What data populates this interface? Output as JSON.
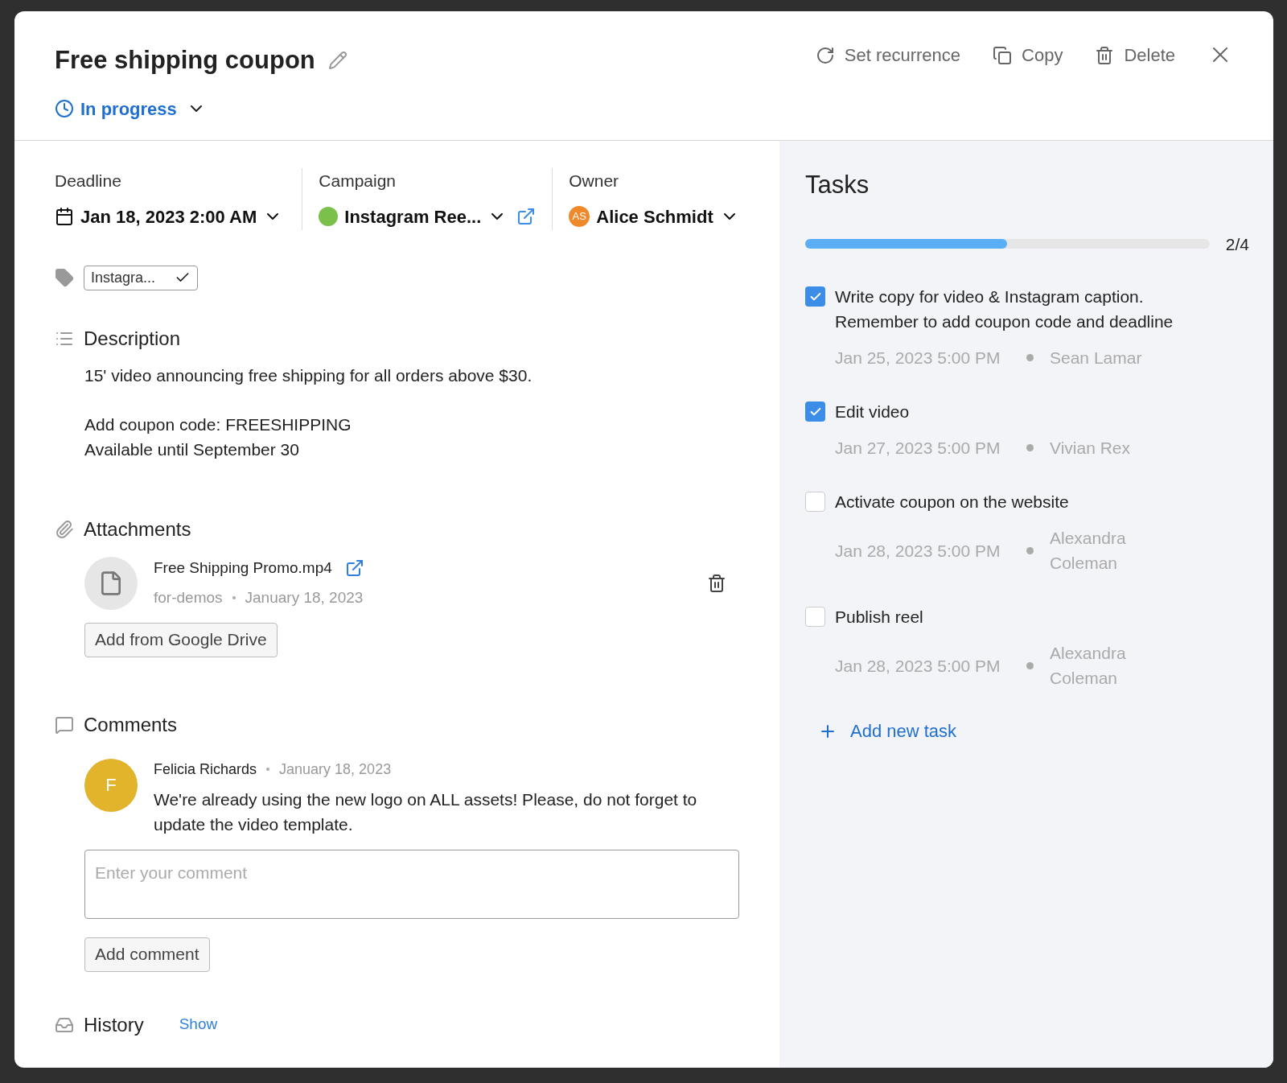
{
  "header": {
    "title": "Free shipping coupon",
    "status": "In progress",
    "actions": [
      {
        "kind": "recurrence",
        "label": "Set recurrence"
      },
      {
        "kind": "copy",
        "label": "Copy"
      },
      {
        "kind": "delete",
        "label": "Delete"
      }
    ]
  },
  "fields": {
    "deadline": {
      "label": "Deadline",
      "value": "Jan 18, 2023 2:00 AM"
    },
    "campaign": {
      "label": "Campaign",
      "value": "Instagram Ree...",
      "color": "#7bc04a"
    },
    "owner": {
      "label": "Owner",
      "initials": "AS",
      "value": "Alice Schmidt"
    }
  },
  "tag": {
    "label": "Instagra..."
  },
  "description": {
    "title": "Description",
    "paragraphs": [
      "15' video announcing free shipping for all orders above $30.",
      "Add coupon code: FREESHIPPING\nAvailable until September 30"
    ]
  },
  "attachments": {
    "title": "Attachments",
    "files": [
      {
        "name": "Free Shipping Promo.mp4",
        "source": "for-demos",
        "date": "January 18, 2023"
      }
    ],
    "button": "Add from Google Drive"
  },
  "comments": {
    "title": "Comments",
    "items": [
      {
        "initial": "F",
        "author": "Felicia Richards",
        "date": "January 18, 2023",
        "text": "We're already using the new logo on ALL assets! Please, do not forget to update the video template."
      }
    ],
    "placeholder": "Enter your comment",
    "button": "Add comment"
  },
  "history": {
    "title": "History",
    "link": "Show"
  },
  "tasks": {
    "title": "Tasks",
    "level": 0.5,
    "count": "2/4",
    "items": [
      {
        "text": "Write copy for video & Instagram caption. Remember to add coupon code and deadline",
        "checked": true,
        "date": "Jan 25, 2023 5:00 PM",
        "assignee": "Sean Lamar"
      },
      {
        "text": "Edit video",
        "checked": true,
        "date": "Jan 27, 2023 5:00 PM",
        "assignee": "Vivian Rex"
      },
      {
        "text": "Activate coupon on the website",
        "checked": false,
        "date": "Jan 28, 2023 5:00 PM",
        "assignee": "Alexandra Coleman"
      },
      {
        "text": "Publish reel",
        "checked": false,
        "date": "Jan 28, 2023 5:00 PM",
        "assignee": "Alexandra Coleman"
      }
    ],
    "add": "Add new task"
  }
}
